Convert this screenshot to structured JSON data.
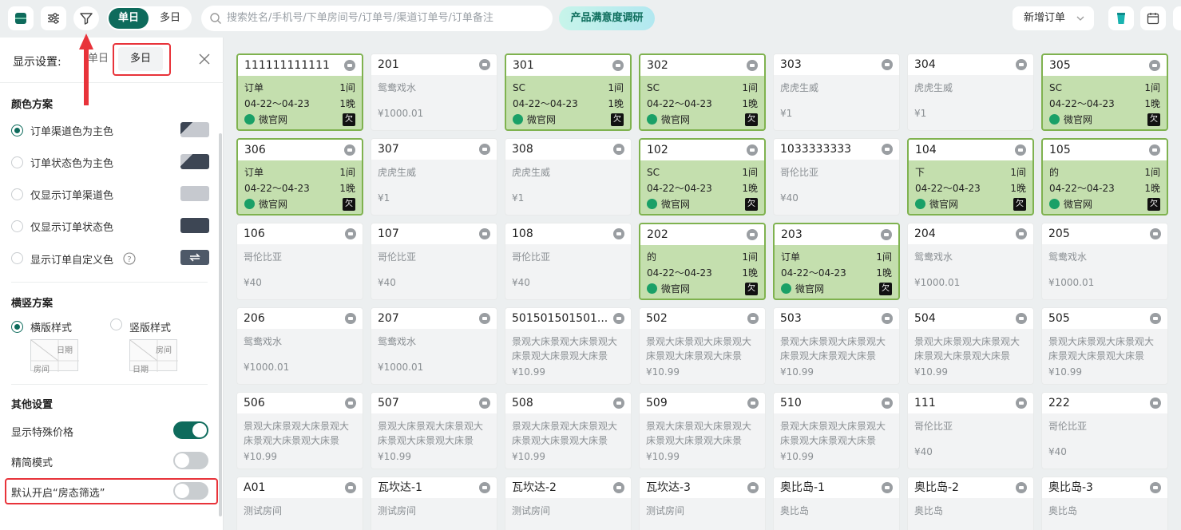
{
  "toolbar": {
    "mode_single": "单日",
    "mode_multi": "多日",
    "search_placeholder": "搜索姓名/手机号/下单房间号/订单号/渠道订单号/订单备注",
    "survey_badge": "产品满意度调研",
    "new_order": "新增订单"
  },
  "panel": {
    "title": "显示设置:",
    "tab_single": "单日",
    "tab_multi": "多日",
    "color_scheme_title": "颜色方案",
    "color_options": [
      {
        "label": "订单渠道色为主色",
        "selected": true
      },
      {
        "label": "订单状态色为主色",
        "selected": false
      },
      {
        "label": "仅显示订单渠道色",
        "selected": false
      },
      {
        "label": "仅显示订单状态色",
        "selected": false
      },
      {
        "label": "显示订单自定义色",
        "selected": false
      }
    ],
    "orient_title": "横竖方案",
    "orient_h": "横版样式",
    "orient_v": "竖版样式",
    "mini_h": {
      "top": "日期",
      "bottom": "房间"
    },
    "mini_v": {
      "top": "房间",
      "bottom": "日期"
    },
    "other_title": "其他设置",
    "toggles": [
      {
        "label": "显示特殊价格",
        "on": true
      },
      {
        "label": "精简模式",
        "on": false
      },
      {
        "label": "默认开启“房态筛选”",
        "on": false
      }
    ]
  },
  "rooms": [
    {
      "name": "111111111111",
      "occ": true,
      "guest": "订单",
      "rooms_count": "1间",
      "dates": "04-22～04-23",
      "nights": "1晚",
      "channel": "微官网",
      "flag": "欠"
    },
    {
      "name": "201",
      "occ": false,
      "type": "鸳鸯戏水",
      "price": "¥1000.01"
    },
    {
      "name": "301",
      "occ": true,
      "guest": "SC",
      "rooms_count": "1间",
      "dates": "04-22～04-23",
      "nights": "1晚",
      "channel": "微官网",
      "flag": "欠"
    },
    {
      "name": "302",
      "occ": true,
      "guest": "SC",
      "rooms_count": "1间",
      "dates": "04-22～04-23",
      "nights": "1晚",
      "channel": "微官网",
      "flag": "欠"
    },
    {
      "name": "303",
      "occ": false,
      "type": "虎虎生威",
      "price": "¥1"
    },
    {
      "name": "304",
      "occ": false,
      "type": "虎虎生威",
      "price": "¥1"
    },
    {
      "name": "305",
      "occ": true,
      "guest": "SC",
      "rooms_count": "1间",
      "dates": "04-22～04-23",
      "nights": "1晚",
      "channel": "微官网",
      "flag": "欠"
    },
    {
      "name": "306",
      "occ": true,
      "guest": "订单",
      "rooms_count": "1间",
      "dates": "04-22～04-23",
      "nights": "1晚",
      "channel": "微官网",
      "flag": "欠"
    },
    {
      "name": "307",
      "occ": false,
      "type": "虎虎生威",
      "price": "¥1"
    },
    {
      "name": "308",
      "occ": false,
      "type": "虎虎生威",
      "price": "¥1"
    },
    {
      "name": "102",
      "occ": true,
      "guest": "SC",
      "rooms_count": "1间",
      "dates": "04-22～04-23",
      "nights": "1晚",
      "channel": "微官网",
      "flag": "欠"
    },
    {
      "name": "1033333333",
      "occ": false,
      "type": "哥伦比亚",
      "price": "¥40"
    },
    {
      "name": "104",
      "occ": true,
      "guest": "下",
      "rooms_count": "1间",
      "dates": "04-22～04-23",
      "nights": "1晚",
      "channel": "微官网",
      "flag": "欠"
    },
    {
      "name": "105",
      "occ": true,
      "guest": "的",
      "rooms_count": "1间",
      "dates": "04-22～04-23",
      "nights": "1晚",
      "channel": "微官网",
      "flag": "欠"
    },
    {
      "name": "106",
      "occ": false,
      "type": "哥伦比亚",
      "price": "¥40"
    },
    {
      "name": "107",
      "occ": false,
      "type": "哥伦比亚",
      "price": "¥40"
    },
    {
      "name": "108",
      "occ": false,
      "type": "哥伦比亚",
      "price": "¥40"
    },
    {
      "name": "202",
      "occ": true,
      "guest": "的",
      "rooms_count": "1间",
      "dates": "04-22～04-23",
      "nights": "1晚",
      "channel": "微官网",
      "flag": "欠"
    },
    {
      "name": "203",
      "occ": true,
      "guest": "订单",
      "rooms_count": "1间",
      "dates": "04-22～04-23",
      "nights": "1晚",
      "channel": "微官网",
      "flag": "欠"
    },
    {
      "name": "204",
      "occ": false,
      "type": "鸳鸯戏水",
      "price": "¥1000.01"
    },
    {
      "name": "205",
      "occ": false,
      "type": "鸳鸯戏水",
      "price": "¥1000.01"
    },
    {
      "name": "206",
      "occ": false,
      "type": "鸳鸯戏水",
      "price": "¥1000.01"
    },
    {
      "name": "207",
      "occ": false,
      "type": "鸳鸯戏水",
      "price": "¥1000.01"
    },
    {
      "name": "501501501501...",
      "occ": false,
      "type": "景观大床景观大床景观大床景观大床景观大床景观...",
      "price": "¥10.99"
    },
    {
      "name": "502",
      "occ": false,
      "type": "景观大床景观大床景观大床景观大床景观大床景观...",
      "price": "¥10.99"
    },
    {
      "name": "503",
      "occ": false,
      "type": "景观大床景观大床景观大床景观大床景观大床景观...",
      "price": "¥10.99"
    },
    {
      "name": "504",
      "occ": false,
      "type": "景观大床景观大床景观大床景观大床景观大床景观...",
      "price": "¥10.99"
    },
    {
      "name": "505",
      "occ": false,
      "type": "景观大床景观大床景观大床景观大床景观大床景观...",
      "price": "¥10.99"
    },
    {
      "name": "506",
      "occ": false,
      "type": "景观大床景观大床景观大床景观大床景观大床景观...",
      "price": "¥10.99"
    },
    {
      "name": "507",
      "occ": false,
      "type": "景观大床景观大床景观大床景观大床景观大床景观...",
      "price": "¥10.99"
    },
    {
      "name": "508",
      "occ": false,
      "type": "景观大床景观大床景观大床景观大床景观大床景观...",
      "price": "¥10.99"
    },
    {
      "name": "509",
      "occ": false,
      "type": "景观大床景观大床景观大床景观大床景观大床景观...",
      "price": "¥10.99"
    },
    {
      "name": "510",
      "occ": false,
      "type": "景观大床景观大床景观大床景观大床景观大床景观...",
      "price": "¥10.99"
    },
    {
      "name": "111",
      "occ": false,
      "type": "哥伦比亚",
      "price": "¥40"
    },
    {
      "name": "222",
      "occ": false,
      "type": "哥伦比亚",
      "price": "¥40"
    },
    {
      "name": "A01",
      "occ": false,
      "type": "测试房间",
      "price": ""
    },
    {
      "name": "瓦坎达-1",
      "occ": false,
      "type": "测试房间",
      "price": ""
    },
    {
      "name": "瓦坎达-2",
      "occ": false,
      "type": "测试房间",
      "price": ""
    },
    {
      "name": "瓦坎达-3",
      "occ": false,
      "type": "测试房间",
      "price": ""
    },
    {
      "name": "奥比岛-1",
      "occ": false,
      "type": "奥比岛",
      "price": ""
    },
    {
      "name": "奥比岛-2",
      "occ": false,
      "type": "奥比岛",
      "price": ""
    },
    {
      "name": "奥比岛-3",
      "occ": false,
      "type": "奥比岛",
      "price": ""
    }
  ]
}
